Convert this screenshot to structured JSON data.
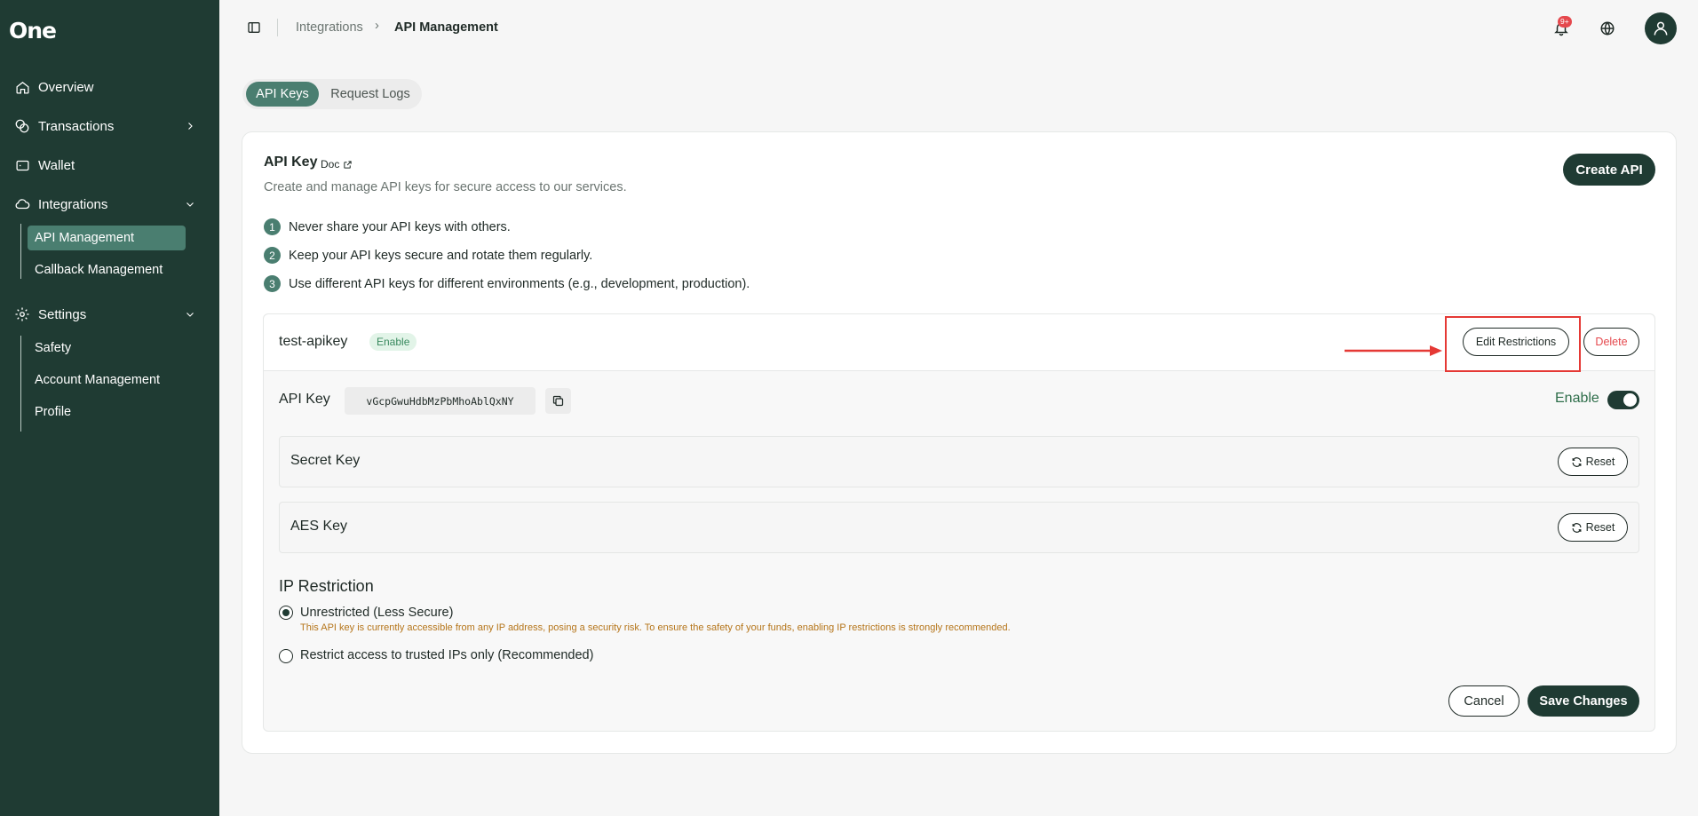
{
  "brand": {
    "logo": "One"
  },
  "sidebar": {
    "items": [
      {
        "label": "Overview",
        "icon": "home-icon"
      },
      {
        "label": "Transactions",
        "icon": "transactions-icon"
      },
      {
        "label": "Wallet",
        "icon": "wallet-icon"
      },
      {
        "label": "Integrations",
        "icon": "integrations-icon"
      },
      {
        "label": "Settings",
        "icon": "gear-icon"
      }
    ],
    "integrations_sub": [
      "API Management",
      "Callback Management"
    ],
    "settings_sub": [
      "Safety",
      "Account Management",
      "Profile"
    ],
    "active_item": "API Management"
  },
  "topbar": {
    "breadcrumb": [
      "Integrations",
      "API Management"
    ],
    "breadcrumb_sep": "›",
    "notification_badge": "9+"
  },
  "tabs": [
    "API Keys",
    "Request Logs"
  ],
  "card": {
    "title": "API Key",
    "doc_label": "Doc",
    "subtitle": "Create and manage API keys for secure access to our services.",
    "create_button": "Create API",
    "tips": [
      {
        "num": "1",
        "text": "Never share your API keys with others."
      },
      {
        "num": "2",
        "text": "Keep your API keys secure and rotate them regularly."
      },
      {
        "num": "3",
        "text": "Use different API keys for different environments (e.g., development, production)."
      }
    ]
  },
  "api_key_item": {
    "name": "test-apikey",
    "status": "Enable",
    "edit_button": "Edit Restrictions",
    "delete_button": "Delete",
    "key_label": "API Key",
    "key_value": "vGcpGwuHdbMzPbMhoAblQxNY",
    "enable_label": "Enable",
    "enabled": true,
    "secret_label": "Secret Key",
    "aes_label": "AES Key",
    "reset_label": "Reset"
  },
  "ip_restriction": {
    "title": "IP Restriction",
    "option_unrestricted": "Unrestricted (Less Secure)",
    "warning": "This API key is currently accessible from any IP address, posing a security risk. To ensure the safety of your funds, enabling IP restrictions is strongly recommended.",
    "option_restricted": "Restrict access to trusted IPs only (Recommended)",
    "selected": "unrestricted"
  },
  "actions": {
    "cancel": "Cancel",
    "save": "Save Changes"
  },
  "colors": {
    "sidebar_bg": "#1f3b33",
    "accent": "#4a7e70",
    "danger": "#e5484d",
    "highlight": "#e53935"
  }
}
